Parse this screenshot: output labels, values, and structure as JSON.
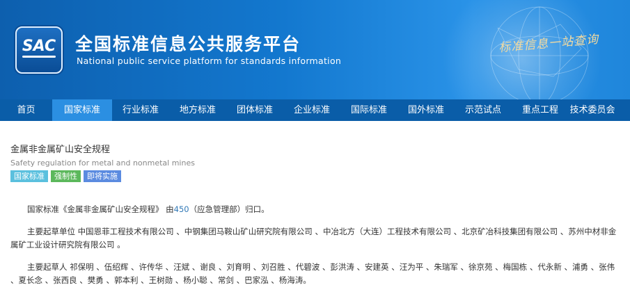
{
  "header": {
    "logo_text": "SAC",
    "title_cn": "全国标准信息公共服务平台",
    "title_en": "National public service platform  for standards information",
    "slogan": "标准信息一站查询"
  },
  "nav": {
    "items": [
      {
        "label": "首页"
      },
      {
        "label": "国家标准"
      },
      {
        "label": "行业标准"
      },
      {
        "label": "地方标准"
      },
      {
        "label": "团体标准"
      },
      {
        "label": "企业标准"
      },
      {
        "label": "国际标准"
      },
      {
        "label": "国外标准"
      },
      {
        "label": "示范试点"
      },
      {
        "label": "重点工程"
      },
      {
        "label": "技术委员会"
      }
    ],
    "active": "国家标准"
  },
  "standard": {
    "title": "金属非金属矿山安全规程",
    "title_en": "Safety regulation for metal and nonmetal mines",
    "tags": [
      "国家标准",
      "强制性",
      "即将实施"
    ],
    "p1": {
      "prefix": "国家标准《金属非金属矿山安全规程》 由",
      "tc_code": "450",
      "suffix": "（应急管理部）归口。"
    },
    "p2": "主要起草单位 中国恩菲工程技术有限公司 、中钢集团马鞍山矿山研究院有限公司 、中冶北方（大连）工程技术有限公司 、北京矿冶科技集团有限公司 、苏州中材非金属矿工业设计研究院有限公司 。",
    "p3": "主要起草人 祁保明 、伍绍辉 、许传华 、汪斌 、谢良 、刘育明 、刘召胜 、代碧波 、彭洪涛 、安建英 、汪为平 、朱瑞军 、徐京苑 、梅国栋 、代永新 、浦勇 、张伟 、夏长念 、张西良 、樊勇 、郭本利 、王树勋 、杨小聪 、常剑 、巴家泓 、杨海涛。"
  }
}
